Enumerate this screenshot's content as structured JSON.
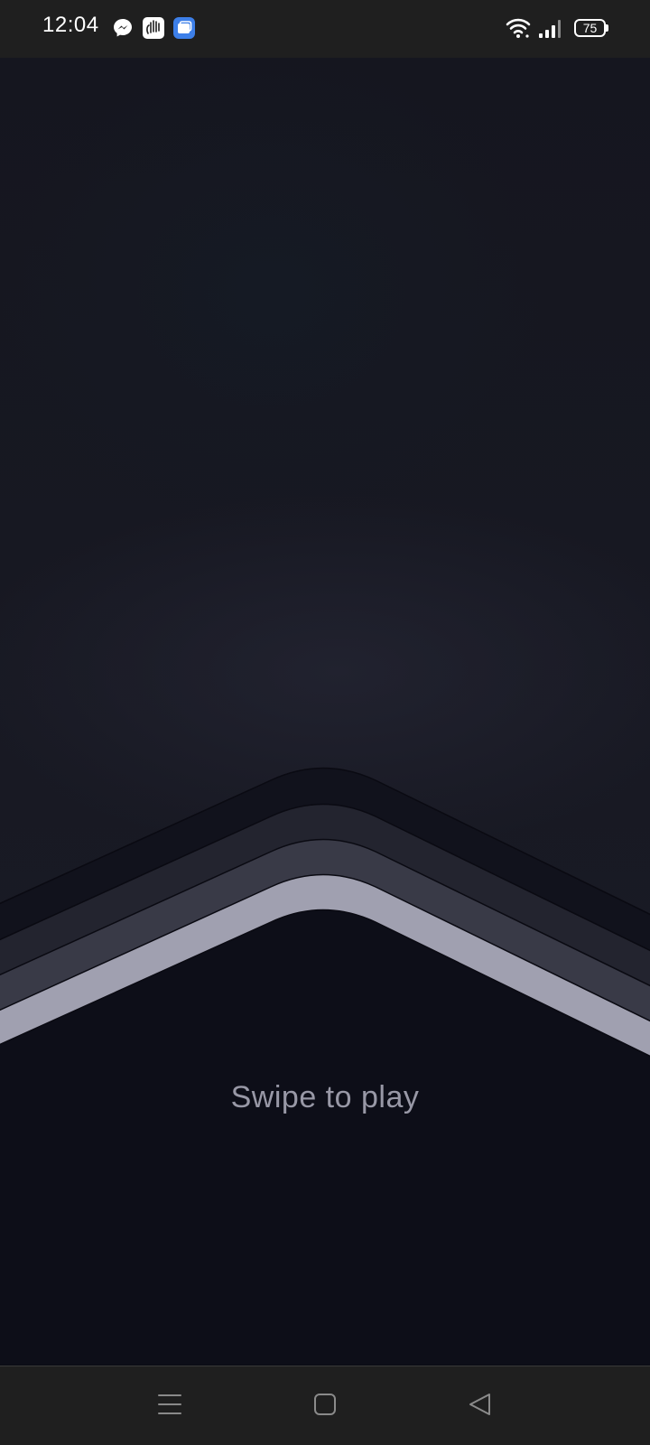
{
  "status_bar": {
    "time": "12:04",
    "notification_icons": [
      "messenger-icon",
      "hand-app-icon",
      "blue-app-icon"
    ],
    "wifi_icon": "wifi-icon",
    "signal_icon": "signal-icon",
    "battery_level": "75"
  },
  "game": {
    "prompt": "Swipe to play",
    "colors": {
      "background": "#0d0e18",
      "chevron_dark": "#11121c",
      "chevron_mid": "#23242f",
      "chevron_light": "#393a47",
      "chevron_highlight": "#a0a0b0",
      "prompt_text": "#9898a6"
    }
  },
  "nav_bar": {
    "buttons": [
      "menu-icon",
      "home-icon",
      "back-icon"
    ]
  }
}
